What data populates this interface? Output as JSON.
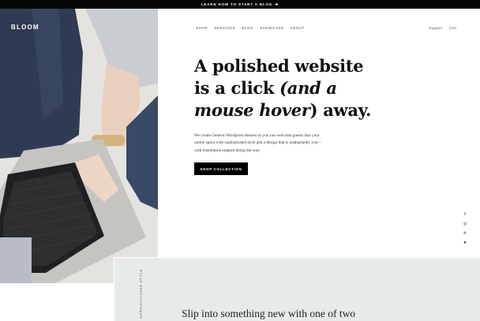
{
  "topbar": {
    "text": "Learn how to start a blog",
    "arrow": "➔"
  },
  "brand": {
    "logo": "BLOOM"
  },
  "nav": {
    "items": [
      "SHOP",
      "SERVICES",
      "BLOG",
      "SHOWCASE",
      "ABOUT"
    ],
    "right": [
      "Support",
      "Cart"
    ]
  },
  "hero": {
    "line1": "A polished website",
    "line2": "is a click ",
    "emph1": "(and a",
    "emph2": "mouse hover",
    "line3_end": ") away.",
    "description": "We create Genesis Wordpress themes so you can welcome guests into your online space with sophisticated style and a design that is unabashedly you—with installation support along the way.",
    "button": "Shop Collection"
  },
  "social": {
    "icons": [
      "facebook-icon",
      "instagram-icon",
      "pinterest-icon",
      "heart-icon"
    ],
    "glyphs": [
      "f",
      "◎",
      "℗",
      "♥"
    ]
  },
  "panel": {
    "vertical_label": "Sophisticated Style",
    "heading": "Slip into something new with one of two"
  },
  "colors": {
    "topbar": "#050505",
    "button": "#000000",
    "panel": "#e6ebea"
  }
}
